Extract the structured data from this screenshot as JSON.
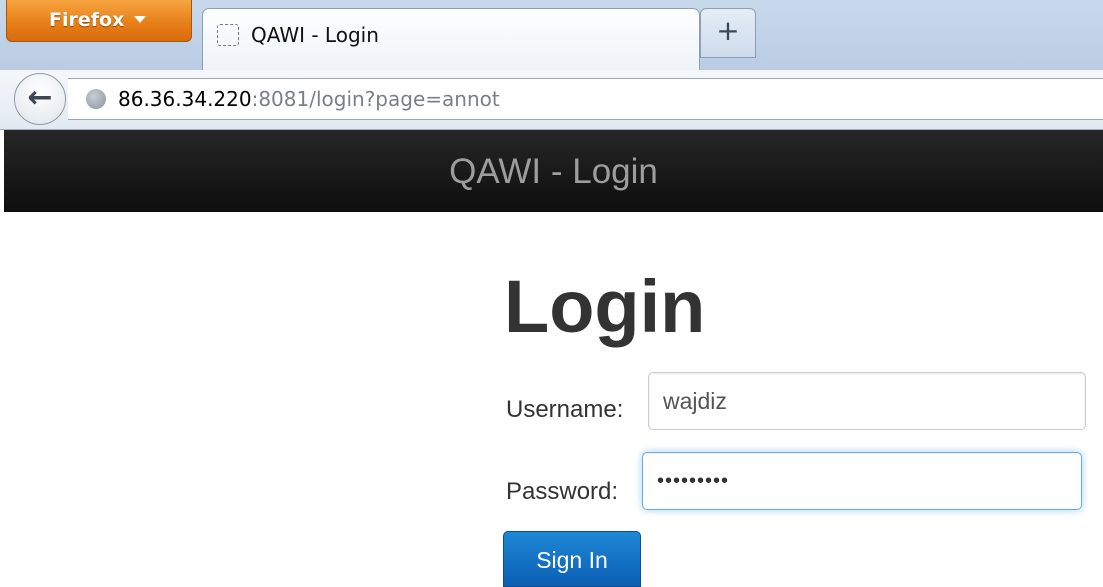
{
  "browser": {
    "menu_button_label": "Firefox",
    "tab_title": "QAWI - Login",
    "new_tab_label": "+",
    "back_icon": "back-arrow-icon",
    "url_host": "86.36.34.220",
    "url_rest": ":8081/login?page=annot"
  },
  "page": {
    "header_title": "QAWI - Login",
    "login_heading": "Login",
    "username_label": "Username:",
    "username_value": "wajdiz",
    "password_label": "Password:",
    "password_value": "wajdiz123",
    "sign_in_label": "Sign In"
  },
  "colors": {
    "firefox_button": "#e8801a",
    "header_background": "#1a1a1a",
    "header_text": "#9d9d9d",
    "primary_button": "#1a7fd0",
    "focus_ring": "#66afe9"
  }
}
